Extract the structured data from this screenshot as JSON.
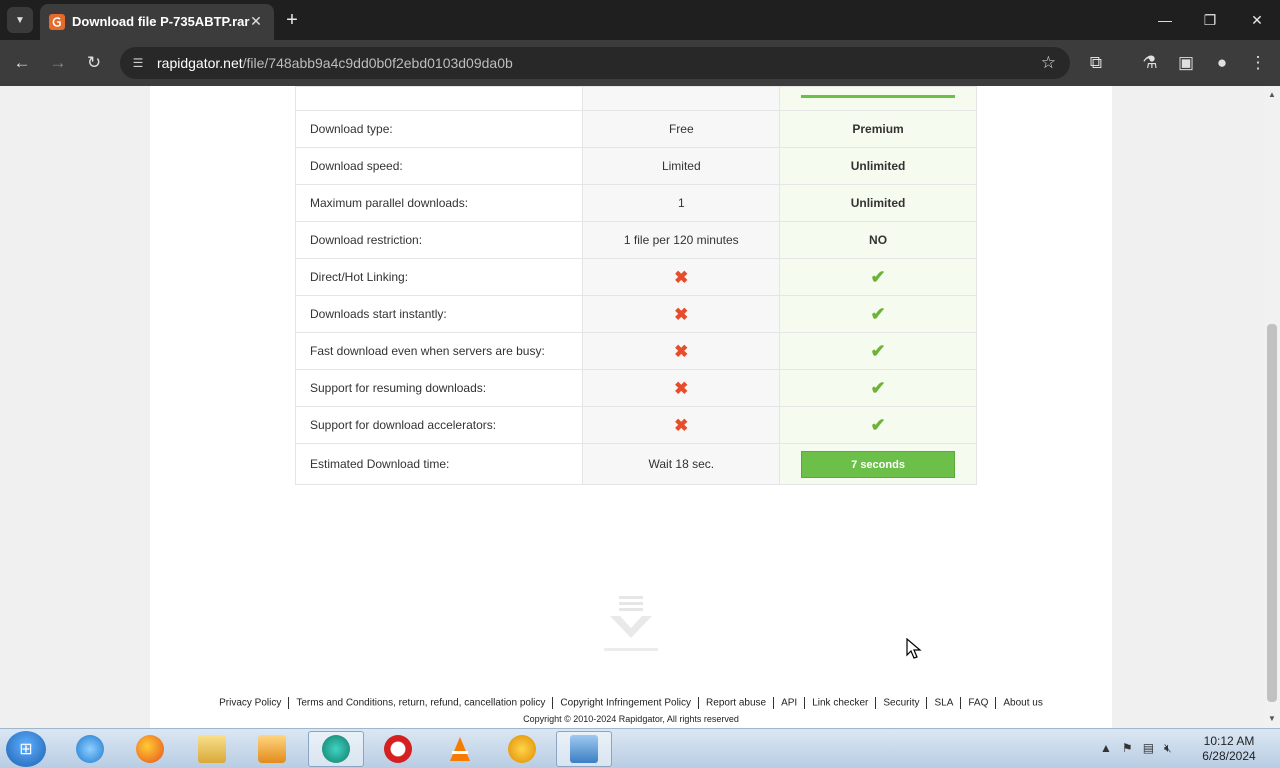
{
  "browser": {
    "tab_title": "Download file P-735ABTP.rar",
    "url_host": "rapidgator.net",
    "url_path": "/file/748abb9a4c9dd0b0f2ebd0103d09da0b"
  },
  "table": {
    "rows": [
      {
        "label": "Download type:",
        "free": "Free",
        "premium": "Premium"
      },
      {
        "label": "Download speed:",
        "free": "Limited",
        "premium": "Unlimited"
      },
      {
        "label": "Maximum parallel downloads:",
        "free": "1",
        "premium": "Unlimited"
      },
      {
        "label": "Download restriction:",
        "free": "1 file per 120 minutes",
        "premium": "NO"
      },
      {
        "label": "Direct/Hot Linking:",
        "free": "✖",
        "premium": "✔"
      },
      {
        "label": "Downloads start instantly:",
        "free": "✖",
        "premium": "✔"
      },
      {
        "label": "Fast download even when servers are busy:",
        "free": "✖",
        "premium": "✔"
      },
      {
        "label": "Support for resuming downloads:",
        "free": "✖",
        "premium": "✔"
      },
      {
        "label": "Support for download accelerators:",
        "free": "✖",
        "premium": "✔"
      }
    ],
    "estimated": {
      "label": "Estimated Download time:",
      "free": "Wait 18 sec.",
      "premium_button": "7 seconds"
    }
  },
  "footer": {
    "links": [
      "Privacy Policy",
      "Terms and Conditions, return, refund, cancellation policy",
      "Copyright Infringement Policy",
      "Report abuse",
      "API",
      "Link checker",
      "Security",
      "SLA",
      "FAQ",
      "About us"
    ],
    "copyright": "Copyright © 2010-2024 Rapidgator, All rights reserved"
  },
  "taskbar": {
    "time": "10:12 AM",
    "date": "6/28/2024"
  },
  "colors": {
    "accent_green": "#6cc04a",
    "cross_red": "#e74c2b",
    "check_green": "#6fb23a"
  }
}
